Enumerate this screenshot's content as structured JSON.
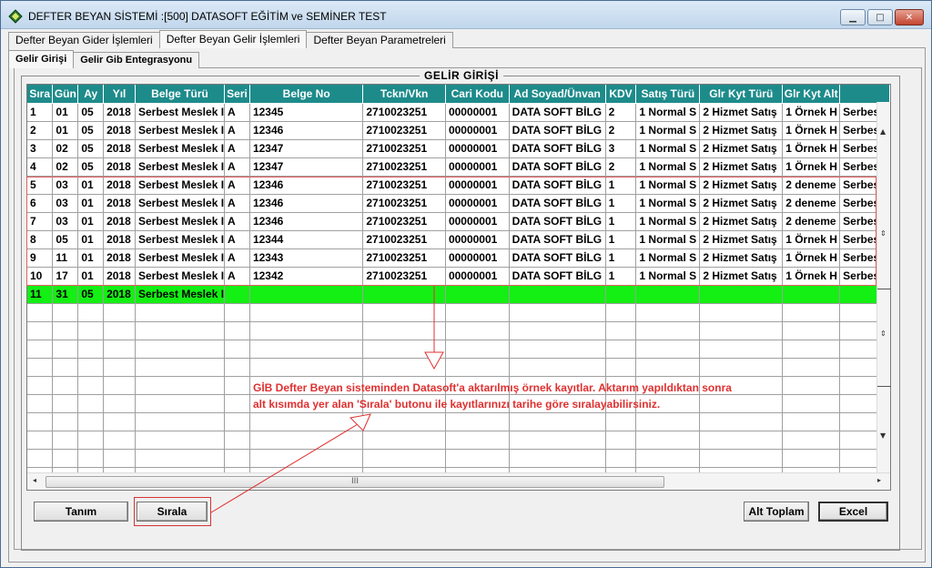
{
  "window": {
    "title": "DEFTER BEYAN SİSTEMİ  :[500]  DATASOFT EĞİTİM ve SEMİNER TEST",
    "minimize": "▁",
    "maximize": "□",
    "close": "✕"
  },
  "main_tabs": [
    {
      "label": "Defter Beyan Gider İşlemleri",
      "active": false
    },
    {
      "label": "Defter Beyan Gelir İşlemleri",
      "active": true
    },
    {
      "label": "Defter Beyan Parametreleri",
      "active": false
    }
  ],
  "sub_tabs": [
    {
      "label": "Gelir Girişi",
      "active": true
    },
    {
      "label": "Gelir Gib Entegrasyonu",
      "active": false
    }
  ],
  "group_title": "GELİR GİRİŞİ",
  "grid": {
    "columns": [
      "Sıra",
      "Gün",
      "Ay",
      "Yıl",
      "Belge Türü",
      "Seri",
      "Belge No",
      "Tckn/Vkn",
      "Cari Kodu",
      "Ad Soyad/Ünvan",
      "KDV",
      "Satış Türü",
      "Glr Kyt Türü",
      "Glr Kyt Alt",
      ""
    ],
    "rows": [
      [
        "1",
        "01",
        "05",
        "2018",
        "Serbest Meslek I",
        "A",
        "12345",
        "2710023251",
        "00000001",
        "DATA SOFT BİLG",
        "2",
        "1  Normal S",
        "2  Hizmet Satış",
        "1 Örnek H",
        "Serbes"
      ],
      [
        "2",
        "01",
        "05",
        "2018",
        "Serbest Meslek I",
        "A",
        "12346",
        "2710023251",
        "00000001",
        "DATA SOFT BİLG",
        "2",
        "1  Normal S",
        "2  Hizmet Satış",
        "1 Örnek H",
        "Serbes"
      ],
      [
        "3",
        "02",
        "05",
        "2018",
        "Serbest Meslek I",
        "A",
        "12347",
        "2710023251",
        "00000001",
        "DATA SOFT BİLG",
        "3",
        "1  Normal S",
        "2  Hizmet Satış",
        "1 Örnek H",
        "Serbes"
      ],
      [
        "4",
        "02",
        "05",
        "2018",
        "Serbest Meslek I",
        "A",
        "12347",
        "2710023251",
        "00000001",
        "DATA SOFT BİLG",
        "2",
        "1  Normal S",
        "2  Hizmet Satış",
        "1 Örnek H",
        "Serbes"
      ],
      [
        "5",
        "03",
        "01",
        "2018",
        "Serbest Meslek I",
        "A",
        "12346",
        "2710023251",
        "00000001",
        "DATA SOFT BİLG",
        "1",
        "1  Normal S",
        "2  Hizmet Satış",
        "2 deneme",
        "Serbes"
      ],
      [
        "6",
        "03",
        "01",
        "2018",
        "Serbest Meslek I",
        "A",
        "12346",
        "2710023251",
        "00000001",
        "DATA SOFT BİLG",
        "1",
        "1  Normal S",
        "2  Hizmet Satış",
        "2 deneme",
        "Serbes"
      ],
      [
        "7",
        "03",
        "01",
        "2018",
        "Serbest Meslek I",
        "A",
        "12346",
        "2710023251",
        "00000001",
        "DATA SOFT BİLG",
        "1",
        "1  Normal S",
        "2  Hizmet Satış",
        "2 deneme",
        "Serbes"
      ],
      [
        "8",
        "05",
        "01",
        "2018",
        "Serbest Meslek I",
        "A",
        "12344",
        "2710023251",
        "00000001",
        "DATA SOFT BİLG",
        "1",
        "1  Normal S",
        "2  Hizmet Satış",
        "1 Örnek H",
        "Serbes"
      ],
      [
        "9",
        "11",
        "01",
        "2018",
        "Serbest Meslek I",
        "A",
        "12343",
        "2710023251",
        "00000001",
        "DATA SOFT BİLG",
        "1",
        "1  Normal S",
        "2  Hizmet Satış",
        "1 Örnek H",
        "Serbes"
      ],
      [
        "10",
        "17",
        "01",
        "2018",
        "Serbest Meslek I",
        "A",
        "12342",
        "2710023251",
        "00000001",
        "DATA SOFT BİLG",
        "1",
        "1  Normal S",
        "2  Hizmet Satış",
        "1 Örnek H",
        "Serbes"
      ],
      [
        "11",
        "31",
        "05",
        "2018",
        "Serbest Meslek I",
        "",
        "",
        "",
        "",
        "",
        "",
        "",
        "",
        "",
        ""
      ]
    ],
    "highlight_color": "#14ef14",
    "header_color": "#1e8b8b",
    "hscroll_grip": "III"
  },
  "annotation": {
    "line1": "GİB Defter Beyan sisteminden Datasoft'a aktarılmış örnek kayıtlar. Aktarım yapıldıktan sonra",
    "line2": "alt kısımda yer alan 'Sırala' butonu ile kayıtlarınızı tarihe göre sıralayabilirsiniz.",
    "color": "#e03030"
  },
  "buttons": {
    "tanim": "Tanım",
    "sirala": "Sırala",
    "alt_toplam": "Alt Toplam",
    "excel": "Excel"
  }
}
